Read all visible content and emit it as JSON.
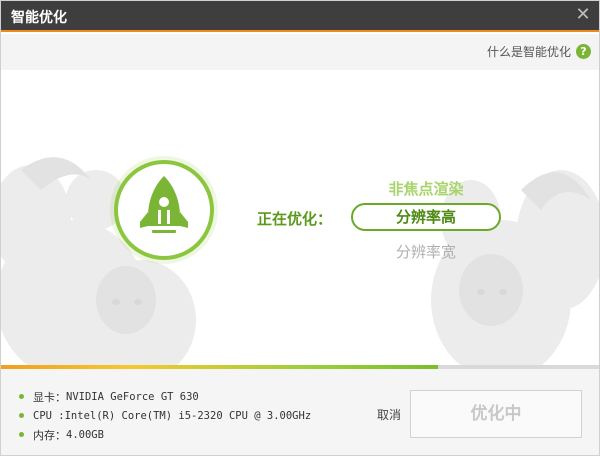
{
  "window": {
    "title": "智能优化",
    "close_glyph": "✕"
  },
  "help": {
    "label": "什么是智能优化",
    "icon": "question-circle-icon",
    "icon_glyph": "?"
  },
  "status": {
    "label": "正在优化：",
    "options": {
      "previous": "非焦点渲染",
      "current": "分辨率高",
      "next": "分辨率宽"
    }
  },
  "progress": {
    "fraction": 0.73
  },
  "system_info": [
    {
      "label": "显卡：",
      "value": "NVIDIA GeForce GT 630"
    },
    {
      "label": "CPU :",
      "value": "Intel(R) Core(TM) i5-2320 CPU @ 3.00GHz"
    },
    {
      "label": "内存：",
      "value": "4.00GB"
    }
  ],
  "actions": {
    "cancel_label": "取消",
    "primary_label": "优化中"
  },
  "colors": {
    "accent_green": "#7bb535",
    "accent_orange": "#f08a1d",
    "titlebar": "#3e3e3e"
  }
}
